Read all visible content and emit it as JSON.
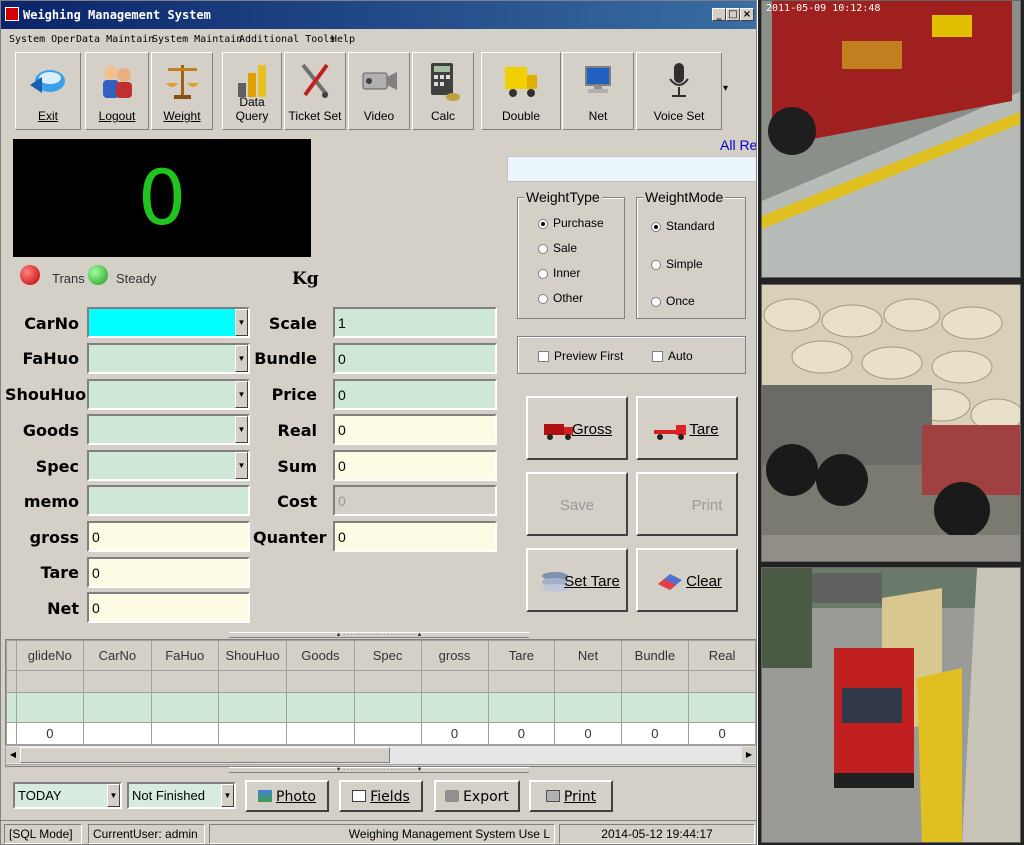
{
  "window": {
    "title": "Weighing Management System",
    "min": "_",
    "max": "□",
    "close": "×"
  },
  "menu": [
    "System Oper",
    "Data Maintain",
    "System Maintain",
    "Additional Tools",
    "Help"
  ],
  "toolbar": [
    {
      "label": "Exit",
      "icon": "exit-icon"
    },
    {
      "label": "Logout",
      "icon": "logout-icon"
    },
    {
      "label": "Weight",
      "icon": "scale-icon"
    },
    {
      "label": "Data Query",
      "icon": "data-query-icon"
    },
    {
      "label": "Ticket Set",
      "icon": "tools-icon"
    },
    {
      "label": "Video",
      "icon": "video-camera-icon"
    },
    {
      "label": "Calc",
      "icon": "calculator-icon"
    },
    {
      "label": "Double",
      "icon": "truck-icon"
    },
    {
      "label": "Net",
      "icon": "network-computer-icon"
    },
    {
      "label": "Voice Set",
      "icon": "microphone-icon"
    }
  ],
  "toolbar_more": "▾",
  "display": {
    "value": "0",
    "unit": "Kg"
  },
  "status_leds": [
    {
      "label": "Trans",
      "color": "#d80000"
    },
    {
      "label": "Steady",
      "color": "#22b422"
    }
  ],
  "all_records": "All Re",
  "fields_left": [
    {
      "label": "CarNo",
      "value": ""
    },
    {
      "label": "FaHuo",
      "value": ""
    },
    {
      "label": "ShouHuo",
      "value": ""
    },
    {
      "label": "Goods",
      "value": ""
    },
    {
      "label": "Spec",
      "value": ""
    },
    {
      "label": "memo",
      "value": ""
    },
    {
      "label": "gross",
      "value": "0"
    },
    {
      "label": "Tare",
      "value": "0"
    },
    {
      "label": "Net",
      "value": "0"
    }
  ],
  "fields_right": [
    {
      "label": "Scale",
      "value": "1"
    },
    {
      "label": "Bundle",
      "value": "0"
    },
    {
      "label": "Price",
      "value": "0"
    },
    {
      "label": "Real",
      "value": "0"
    },
    {
      "label": "Sum",
      "value": "0"
    },
    {
      "label": "Cost",
      "value": "0"
    },
    {
      "label": "Quanter",
      "value": "0"
    }
  ],
  "weight_type": {
    "title": "WeightType",
    "options": [
      "Purchase",
      "Sale",
      "Inner",
      "Other"
    ],
    "selected": "Purchase"
  },
  "weight_mode": {
    "title": "WeightMode",
    "options": [
      "Standard",
      "Simple",
      "Once"
    ],
    "selected": "Standard"
  },
  "options": [
    {
      "label": "Preview First",
      "checked": false
    },
    {
      "label": "Auto",
      "checked": false
    }
  ],
  "actions": {
    "gross": "Gross",
    "tare": "Tare",
    "save": "Save",
    "print": "Print",
    "set_tare": "Set Tare",
    "clear": "Clear"
  },
  "grid": {
    "columns": [
      "glideNo",
      "CarNo",
      "FaHuo",
      "ShouHuo",
      "Goods",
      "Spec",
      "gross",
      "Tare",
      "Net",
      "Bundle",
      "Real"
    ],
    "totals": [
      "0",
      "",
      "",
      "",
      "",
      "",
      "0",
      "0",
      "0",
      "0",
      "0"
    ]
  },
  "bottom": {
    "date_filter": "TODAY",
    "state_filter": "Not Finished",
    "photo": "Photo",
    "fields": "Fields",
    "export": "Export",
    "print": "Print"
  },
  "status": {
    "mode": "[SQL Mode]",
    "user": "CurrentUser: admin",
    "product": "Weighing Management System Use L",
    "datetime": "2014-05-12 19:44:17"
  },
  "camera": {
    "timestamp": "2011-05-09 10:12:48"
  },
  "colors": {
    "title_start": "#0a246a",
    "title_end": "#3a6ea5",
    "display_digit": "#1fc41f",
    "field_green": "#cfe8d6",
    "field_yellow": "#fdfbe4",
    "field_active": "#00ffff"
  }
}
